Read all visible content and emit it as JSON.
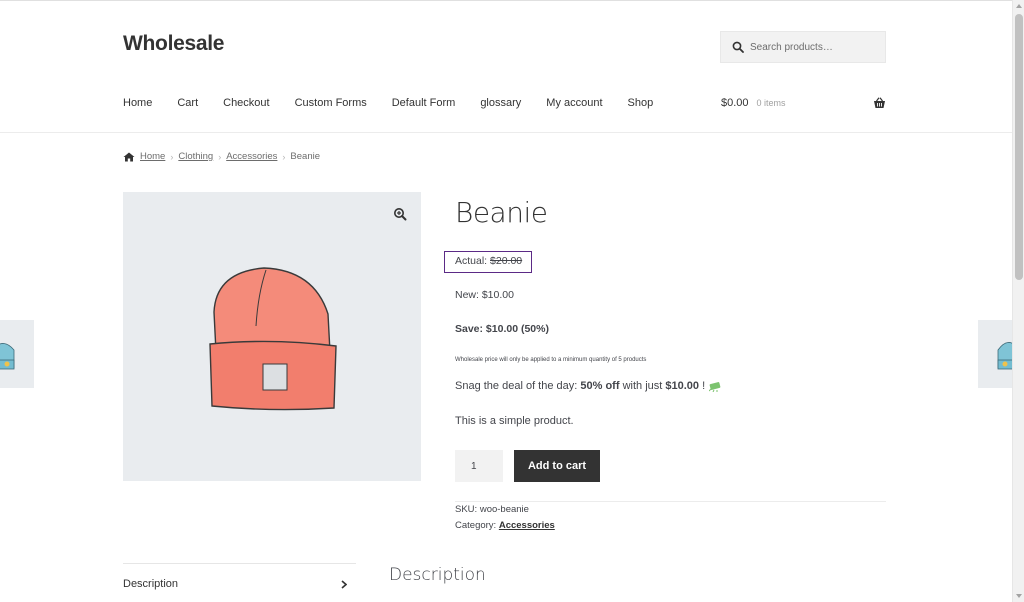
{
  "header": {
    "site_title": "Wholesale",
    "search_placeholder": "Search products…",
    "nav": [
      "Home",
      "Cart",
      "Checkout",
      "Custom Forms",
      "Default Form",
      "glossary",
      "My account",
      "Shop"
    ],
    "cart_amount": "$0.00",
    "cart_count": "0 items"
  },
  "breadcrumb": {
    "items": [
      "Home",
      "Clothing",
      "Accessories"
    ],
    "current": "Beanie"
  },
  "product": {
    "title": "Beanie",
    "actual_label": "Actual:",
    "actual_price": "$20.00",
    "new_price": "New: $10.00",
    "save": "Save: $10.00 (50%)",
    "wholesale_note": "Wholesale price will only be applied to a minimum quantity of 5 products",
    "deal_prefix": "Snag the deal of the day:",
    "deal_off": "50% off",
    "deal_mid": "with just",
    "deal_price": "$10.00",
    "deal_suffix": "!",
    "short_description": "This is a simple product.",
    "quantity": "1",
    "add_to_cart": "Add to cart",
    "sku_label": "SKU:",
    "sku": "woo-beanie",
    "category_label": "Category:",
    "category": "Accessories"
  },
  "tabs": {
    "description_tab": "Description",
    "description_heading": "Description"
  },
  "colors": {
    "accent": "#333333",
    "highlight_border": "#5b2a86",
    "beanie": "#f48b7a",
    "gallery_bg": "#e9ecef"
  }
}
